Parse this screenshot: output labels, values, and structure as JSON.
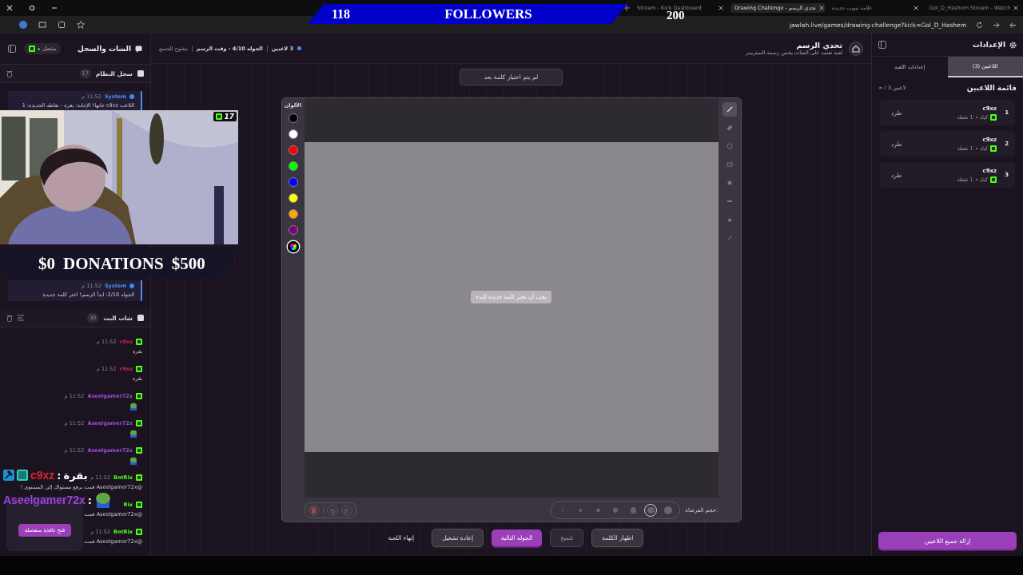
{
  "browser": {
    "tabs": [
      {
        "title": "Gol_D_Hashem Stream - Watch",
        "selected": false
      },
      {
        "title": "علامة تبويب جديدة",
        "selected": false
      },
      {
        "title": "Drawing Challenge - تحدي الرسم",
        "selected": true
      },
      {
        "title": "Stream - Kick Dashboard",
        "selected": false
      }
    ],
    "url": "jawlah.live/games/drawing-challenge?kick=Gol_D_Hashem"
  },
  "left_panel": {
    "title": "الشات والسجل",
    "connection": "متصل",
    "system_log": {
      "title": "سجل النظام",
      "count": "17",
      "entries": [
        {
          "sender": "System",
          "time": "11:52 م",
          "text": "اللاعب c9xz جابها! الإجابة: بقرة - نقاطه الجديدة: 1"
        },
        {
          "sender": "System",
          "time": "11:52 م",
          "text": "الجوله 2/10: ابدأ الرسم! اختر كلمة جديدة"
        }
      ]
    },
    "chat": {
      "title": "شات البث",
      "count": "30",
      "messages": [
        {
          "user": "c9xz",
          "color": "#c0245a",
          "time": "11:52 م",
          "kind": "text",
          "text": "بقرة"
        },
        {
          "user": "c9xz",
          "color": "#c0245a",
          "time": "11:52 م",
          "kind": "text",
          "text": "بقرة"
        },
        {
          "user": "Aseelgamer72x",
          "color": "#9b4dd9",
          "time": "11:52 م",
          "kind": "emote"
        },
        {
          "user": "Aseelgamer72x",
          "color": "#9b4dd9",
          "time": "11:52 م",
          "kind": "emote"
        },
        {
          "user": "Aseelgamer72x",
          "color": "#9b4dd9",
          "time": "11:52 م",
          "kind": "emote"
        },
        {
          "user": "BotRix",
          "color": "#53fc18",
          "time": "11:52 م",
          "kind": "text",
          "text": "@Aseelgamer72x قمت برفع مستواك إلى المستوى !"
        },
        {
          "user": "Rix",
          "color": "#53fc18",
          "kind": "text",
          "text": "@Aseelgamer72x قمت"
        },
        {
          "user": "BotRix",
          "color": "#53fc18",
          "time": "11:52 م",
          "kind": "text",
          "text": "@Aseelgamer72x قمت"
        }
      ]
    },
    "popup_button": "فتح نافذة منفصلة"
  },
  "game": {
    "title": "تحدي الرسم",
    "subtitle": "لعبة تعتمد على الشات يخمن رسمة الستريمر",
    "players": "3 لاعبين",
    "round": "الجوله 4/10 - وقت الرسم",
    "mode": "مفتوح للجميع",
    "word_status": "لم يتم اختيار كلمة بعد",
    "colors_label": "الألوان",
    "colors": [
      {
        "color": "#000000",
        "kind": "swatch",
        "selected": false
      },
      {
        "color": "#ffffff",
        "kind": "swatch",
        "selected": false
      },
      {
        "color": "#ff0000",
        "kind": "swatch",
        "selected": false
      },
      {
        "color": "#00ff00",
        "kind": "swatch",
        "selected": false
      },
      {
        "color": "#0000ff",
        "kind": "swatch",
        "selected": false
      },
      {
        "color": "#ffff00",
        "kind": "swatch",
        "selected": false
      },
      {
        "color": "#ffa500",
        "kind": "swatch",
        "selected": false
      },
      {
        "color": "#800080",
        "kind": "swatch",
        "selected": false
      },
      {
        "color": "#000000",
        "kind": "picker",
        "selected": true
      }
    ],
    "tools": [
      {
        "kind": "pencil",
        "selected": true
      },
      {
        "kind": "eraser",
        "selected": false
      },
      {
        "kind": "circle",
        "selected": false
      },
      {
        "kind": "rectangle",
        "selected": false
      },
      {
        "kind": "dot",
        "selected": false
      },
      {
        "kind": "line",
        "selected": false
      },
      {
        "kind": "fill",
        "selected": false
      },
      {
        "kind": "pen",
        "selected": false
      }
    ],
    "canvas_message": "يجب أن تختر كلمة جديدة للبدء",
    "brush_label": "حجم الفرشاة:",
    "brush_sizes": [
      {
        "selected": false
      },
      {
        "selected": true
      },
      {
        "selected": false
      },
      {
        "selected": false
      },
      {
        "selected": false
      },
      {
        "selected": false
      },
      {
        "selected": false
      }
    ],
    "buttons": [
      {
        "label": "اظهار الكلمة",
        "kind": "secondary"
      },
      {
        "label": "تلميح",
        "kind": "muted"
      },
      {
        "label": "الجوله التالية",
        "kind": "primary"
      },
      {
        "label": "إعادة تشغيل",
        "kind": "secondary"
      },
      {
        "label": "إنهاء اللعبة",
        "kind": "plain"
      }
    ]
  },
  "right_panel": {
    "title": "الإعدادات",
    "tabs": [
      {
        "label": "اللاعبين (3)",
        "selected": true
      },
      {
        "label": "إعدادات اللعبة",
        "selected": false
      }
    ],
    "list_title": "قائمة اللاعبين",
    "capacity": "∞ / 3 لاعبين",
    "players": [
      {
        "rank": "1",
        "name": "c9xz",
        "platform": "كيك",
        "points": "1 نقطة",
        "action": "طرد"
      },
      {
        "rank": "2",
        "name": "c9xz",
        "platform": "كيك",
        "points": "1 نقطة",
        "action": "طرد"
      },
      {
        "rank": "3",
        "name": "c9xz",
        "platform": "كيك",
        "points": "1 نقطة",
        "action": "طرد"
      }
    ],
    "remove_all": "إزالة جميع اللاعبين"
  },
  "overlays": {
    "followers": {
      "current": "118",
      "label": "FOLLOWERS",
      "goal": "200"
    },
    "donations": {
      "current": "$0",
      "label": "DONATIONS",
      "goal": "$500"
    },
    "webcam": {
      "kind": "picture",
      "badge": "17"
    },
    "chat_lines": [
      {
        "user": "c9xz",
        "color": "#e0202a",
        "separator": ":",
        "kind": "text",
        "text": "بقرة"
      },
      {
        "user": "Aseelgamer72x",
        "color": "#9b3fe0",
        "separator": ":",
        "kind": "emote"
      }
    ]
  }
}
